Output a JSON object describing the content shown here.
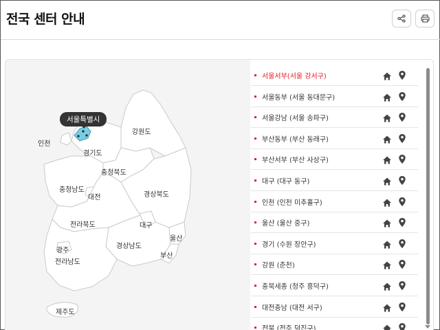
{
  "page": {
    "title": "전국 센터 안내"
  },
  "toolbar": {
    "share_icon": "share-icon",
    "print_icon": "print-icon"
  },
  "map": {
    "tooltip": "서울특별시",
    "highlight_color": "#7ccbe0",
    "regions": [
      {
        "id": "incheon",
        "label": "인천"
      },
      {
        "id": "gyeonggi",
        "label": "경기도"
      },
      {
        "id": "gangwon",
        "label": "강원도"
      },
      {
        "id": "chungbuk",
        "label": "충청북도"
      },
      {
        "id": "chungnam",
        "label": "충청남도"
      },
      {
        "id": "daejeon",
        "label": "대전"
      },
      {
        "id": "gyeongbuk",
        "label": "경상북도"
      },
      {
        "id": "jeonbuk",
        "label": "전라북도"
      },
      {
        "id": "daegu",
        "label": "대구"
      },
      {
        "id": "ulsan",
        "label": "울산"
      },
      {
        "id": "gwangju",
        "label": "광주"
      },
      {
        "id": "gyeongnam",
        "label": "경상남도"
      },
      {
        "id": "busan",
        "label": "부산"
      },
      {
        "id": "jeonnam",
        "label": "전라남도"
      },
      {
        "id": "jeju",
        "label": "제주도"
      }
    ]
  },
  "centers": [
    {
      "label": "서울서부(서울 강서구)",
      "active": true
    },
    {
      "label": "서울동부 (서울 동대문구)",
      "active": false
    },
    {
      "label": "서울강남 (서울 송파구)",
      "active": false
    },
    {
      "label": "부산동부 (부산 동래구)",
      "active": false
    },
    {
      "label": "부산서부 (부산 사상구)",
      "active": false
    },
    {
      "label": "대구 (대구 동구)",
      "active": false
    },
    {
      "label": "인천 (인천 미추홀구)",
      "active": false
    },
    {
      "label": "울산 (울산 중구)",
      "active": false
    },
    {
      "label": "경기 (수원 장안구)",
      "active": false
    },
    {
      "label": "강원 (춘천)",
      "active": false
    },
    {
      "label": "충북세종 (청주 흥덕구)",
      "active": false
    },
    {
      "label": "대전충남 (대전 서구)",
      "active": false
    },
    {
      "label": "전북 (전주 덕진구)",
      "active": false
    }
  ],
  "colors": {
    "accent": "#e0202a",
    "map_fill": "#ffffff",
    "map_stroke": "#c9c9c9"
  }
}
